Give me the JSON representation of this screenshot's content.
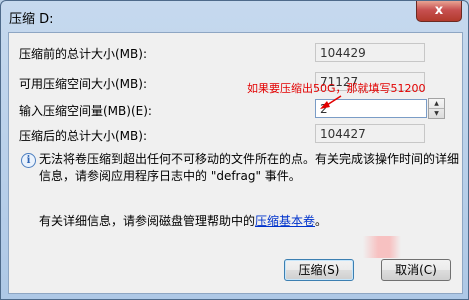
{
  "window": {
    "title": "压缩 D:",
    "close_label": "x"
  },
  "rows": [
    {
      "label": "压缩前的总计大小(MB):",
      "value": "104429"
    },
    {
      "label": "可用压缩空间大小(MB):",
      "value": "71127"
    },
    {
      "label": "输入压缩空间量(MB)(E):",
      "value": "2"
    },
    {
      "label": "压缩后的总计大小(MB):",
      "value": "104427"
    }
  ],
  "annotation": "如果要压缩出50G，那就填写51200",
  "info": {
    "icon": "info-icon",
    "text": "无法将卷压缩到超出任何不可移动的文件所在的点。有关完成该操作时间的详细信息，请参阅应用程序日志中的 \"defrag\" 事件。"
  },
  "help": {
    "prefix": "有关详细信息，请参阅磁盘管理帮助中的",
    "link": "压缩基本卷",
    "suffix": "。"
  },
  "buttons": {
    "shrink": "压缩(S)",
    "cancel": "取消(C)"
  },
  "colors": {
    "annotation": "#e20000",
    "link": "#0033cc"
  }
}
